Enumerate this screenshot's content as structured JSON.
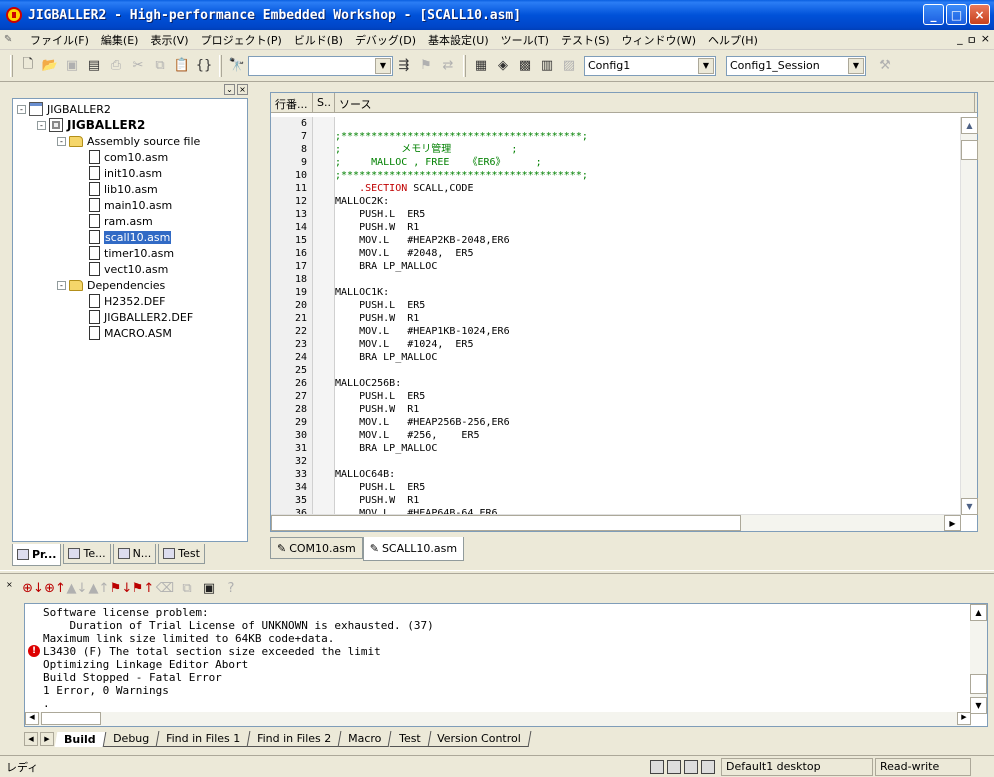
{
  "window": {
    "title": "JIGBALLER2 - High-performance Embedded Workshop - [SCALL10.asm]",
    "controls": {
      "minimize": "_",
      "maximize": "□",
      "close": "×"
    }
  },
  "menu": {
    "items": [
      "ファイル(F)",
      "編集(E)",
      "表示(V)",
      "プロジェクト(P)",
      "ビルド(B)",
      "デバッグ(D)",
      "基本設定(U)",
      "ツール(T)",
      "テスト(S)",
      "ウィンドウ(W)",
      "ヘルプ(H)"
    ],
    "mdi_controls": {
      "minimize": "_",
      "restore": "ㅁ",
      "close": "×"
    }
  },
  "toolbar": {
    "search_combo": "",
    "config_combo": "Config1",
    "session_combo": "Config1_Session"
  },
  "workspace": {
    "header_controls": {
      "pin": "⌄",
      "close": "×"
    },
    "tree": [
      {
        "label": "JIGBALLER2",
        "level": 0,
        "type": "ws",
        "expander": "-"
      },
      {
        "label": "JIGBALLER2",
        "level": 1,
        "type": "proj",
        "bold": true,
        "expander": "-"
      },
      {
        "label": "Assembly source file",
        "level": 2,
        "type": "folder",
        "expander": "-"
      },
      {
        "label": "com10.asm",
        "level": 3,
        "type": "file"
      },
      {
        "label": "init10.asm",
        "level": 3,
        "type": "file"
      },
      {
        "label": "lib10.asm",
        "level": 3,
        "type": "file"
      },
      {
        "label": "main10.asm",
        "level": 3,
        "type": "file"
      },
      {
        "label": "ram.asm",
        "level": 3,
        "type": "file"
      },
      {
        "label": "scall10.asm",
        "level": 3,
        "type": "file",
        "selected": true
      },
      {
        "label": "timer10.asm",
        "level": 3,
        "type": "file"
      },
      {
        "label": "vect10.asm",
        "level": 3,
        "type": "file"
      },
      {
        "label": "Dependencies",
        "level": 2,
        "type": "folder",
        "expander": "-"
      },
      {
        "label": "H2352.DEF",
        "level": 3,
        "type": "file"
      },
      {
        "label": "JIGBALLER2.DEF",
        "level": 3,
        "type": "file"
      },
      {
        "label": "MACRO.ASM",
        "level": 3,
        "type": "file"
      }
    ],
    "tabs": [
      "Pr...",
      "Te...",
      "N...",
      "Test"
    ]
  },
  "editor": {
    "columns": [
      "行番...",
      "S..",
      "ソース"
    ],
    "lines": [
      {
        "n": "6",
        "text": "",
        "kind": "code"
      },
      {
        "n": "7",
        "text": ";****************************************;",
        "kind": "comment"
      },
      {
        "n": "8",
        "text": ";          メモリ管理          ;",
        "kind": "comment"
      },
      {
        "n": "9",
        "text": ";     MALLOC , FREE   《ER6》     ;",
        "kind": "comment"
      },
      {
        "n": "10",
        "text": ";****************************************;",
        "kind": "comment"
      },
      {
        "n": "11",
        "text": "    .SECTION",
        "extra": " SCALL,CODE",
        "kind": "directive"
      },
      {
        "n": "12",
        "text": "MALLOC2K:",
        "kind": "code"
      },
      {
        "n": "13",
        "text": "    PUSH.L  ER5",
        "kind": "code"
      },
      {
        "n": "14",
        "text": "    PUSH.W  R1",
        "kind": "code"
      },
      {
        "n": "15",
        "text": "    MOV.L   #HEAP2KB-2048,ER6",
        "kind": "code"
      },
      {
        "n": "16",
        "text": "    MOV.L   #2048,  ER5",
        "kind": "code"
      },
      {
        "n": "17",
        "text": "    BRA LP_MALLOC",
        "kind": "code"
      },
      {
        "n": "18",
        "text": "",
        "kind": "code"
      },
      {
        "n": "19",
        "text": "MALLOC1K:",
        "kind": "code"
      },
      {
        "n": "20",
        "text": "    PUSH.L  ER5",
        "kind": "code"
      },
      {
        "n": "21",
        "text": "    PUSH.W  R1",
        "kind": "code"
      },
      {
        "n": "22",
        "text": "    MOV.L   #HEAP1KB-1024,ER6",
        "kind": "code"
      },
      {
        "n": "23",
        "text": "    MOV.L   #1024,  ER5",
        "kind": "code"
      },
      {
        "n": "24",
        "text": "    BRA LP_MALLOC",
        "kind": "code"
      },
      {
        "n": "25",
        "text": "",
        "kind": "code"
      },
      {
        "n": "26",
        "text": "MALLOC256B:",
        "kind": "code"
      },
      {
        "n": "27",
        "text": "    PUSH.L  ER5",
        "kind": "code"
      },
      {
        "n": "28",
        "text": "    PUSH.W  R1",
        "kind": "code"
      },
      {
        "n": "29",
        "text": "    MOV.L   #HEAP256B-256,ER6",
        "kind": "code"
      },
      {
        "n": "30",
        "text": "    MOV.L   #256,    ER5",
        "kind": "code"
      },
      {
        "n": "31",
        "text": "    BRA LP_MALLOC",
        "kind": "code"
      },
      {
        "n": "32",
        "text": "",
        "kind": "code"
      },
      {
        "n": "33",
        "text": "MALLOC64B:",
        "kind": "code"
      },
      {
        "n": "34",
        "text": "    PUSH.L  ER5",
        "kind": "code"
      },
      {
        "n": "35",
        "text": "    PUSH.W  R1",
        "kind": "code"
      },
      {
        "n": "36",
        "text": "    MOV.L   #HEAP64B-64,ER6",
        "kind": "code"
      }
    ],
    "doc_tabs": [
      {
        "label": "COM10.asm",
        "active": false
      },
      {
        "label": "SCALL10.asm",
        "active": true
      }
    ]
  },
  "output": {
    "lines": [
      {
        "text": "Software license problem:",
        "error": false
      },
      {
        "text": "    Duration of Trial License of UNKNOWN is exhausted. (37)",
        "error": false
      },
      {
        "text": "Maximum link size limited to 64KB code+data.",
        "error": false
      },
      {
        "text": "L3430 (F) The total section size exceeded the limit",
        "error": true
      },
      {
        "text": "Optimizing Linkage Editor Abort",
        "error": false
      },
      {
        "text": "Build Stopped - Fatal Error",
        "error": false
      },
      {
        "text": "1 Error, 0 Warnings",
        "error": false
      },
      {
        "text": ".",
        "error": false
      }
    ],
    "tabs": [
      {
        "label": "Build",
        "active": true
      },
      {
        "label": "Debug",
        "active": false
      },
      {
        "label": "Find in Files 1",
        "active": false
      },
      {
        "label": "Find in Files 2",
        "active": false
      },
      {
        "label": "Macro",
        "active": false
      },
      {
        "label": "Test",
        "active": false
      },
      {
        "label": "Version Control",
        "active": false
      }
    ]
  },
  "statusbar": {
    "left": "レディ",
    "desktop": "Default1 desktop",
    "mode": "Read-write"
  }
}
